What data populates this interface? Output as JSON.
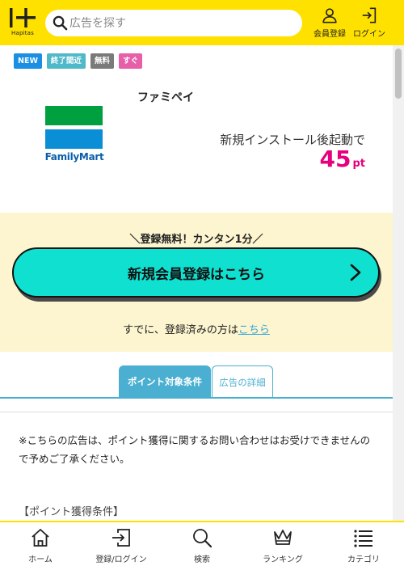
{
  "header": {
    "logo_text": "Hapitas",
    "search_placeholder": "広告を探す",
    "register_label": "会員登録",
    "login_label": "ログイン"
  },
  "tags": [
    {
      "label": "NEW",
      "color": "#1a8fe3"
    },
    {
      "label": "終了間近",
      "color": "#4fb9c9"
    },
    {
      "label": "無料",
      "color": "#7a7a7a"
    },
    {
      "label": "すぐ",
      "color": "#e65fa8"
    }
  ],
  "offer": {
    "app_name": "ファミペイ",
    "brand_name": "FamilyMart",
    "condition": "新規インストール後起動で",
    "points_value": "45",
    "points_unit": "pt"
  },
  "registration": {
    "catch": "登録無料！カンタン1分",
    "button_label": "新規会員登録はこちら",
    "login_prefix": "すでに、登録済みの方は",
    "login_link": "こちら"
  },
  "tabs": [
    {
      "label": "ポイント対象条件",
      "active": true
    },
    {
      "label": "広告の詳細",
      "active": false
    }
  ],
  "notice": "※こちらの広告は、ポイント獲得に関するお問い合わせはお受けできませんので予めご了承ください。",
  "conditions_heading": "【ポイント獲得条件】",
  "bottom_nav": [
    {
      "label": "ホーム",
      "icon": "home-icon"
    },
    {
      "label": "登録/ログイン",
      "icon": "login-icon"
    },
    {
      "label": "検索",
      "icon": "search-icon"
    },
    {
      "label": "ランキング",
      "icon": "crown-icon"
    },
    {
      "label": "カテゴリ",
      "icon": "menu-icon"
    }
  ],
  "colors": {
    "brand_yellow": "#ffe100",
    "register_button": "#10e0d0",
    "points_pink": "#e6007e",
    "tab_blue": "#4aafd0",
    "band_bg": "#fcf5cf"
  }
}
